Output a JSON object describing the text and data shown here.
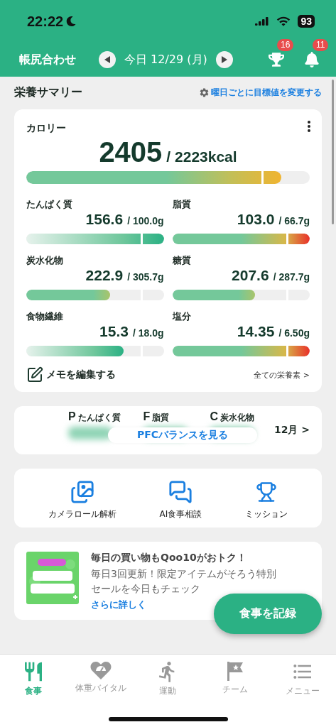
{
  "status_bar": {
    "time": "22:22",
    "battery": "93"
  },
  "header": {
    "title": "帳尻合わせ",
    "date": "今日 12/29 (月)",
    "badges": [
      {
        "kind": "trophy",
        "count": "16"
      },
      {
        "kind": "bell",
        "count": "11"
      }
    ]
  },
  "section": {
    "title": "栄養サマリー",
    "link": "曜日ごとに目標値を変更する"
  },
  "calorie": {
    "label": "カロリー",
    "value": "2405",
    "target": "/ 2223kcal",
    "level": 0.9,
    "kind": "amber"
  },
  "nutrients": [
    {
      "label": "たんぱく質",
      "value": "156.6",
      "target": "/ 100.0g",
      "level": 1,
      "kind": "fade"
    },
    {
      "label": "脂質",
      "value": "103.0",
      "target": "/ 66.7g",
      "level": 1,
      "kind": "warn"
    },
    {
      "label": "炭水化物",
      "value": "222.9",
      "target": "/ 305.7g",
      "level": 0.61,
      "kind": "green"
    },
    {
      "label": "糖質",
      "value": "207.6",
      "target": "/ 287.7g",
      "level": 0.6,
      "kind": "green"
    },
    {
      "label": "食物繊維",
      "value": "15.3",
      "target": "/ 18.0g",
      "level": 0.71,
      "kind": "fade"
    },
    {
      "label": "塩分",
      "value": "14.35",
      "target": "/ 6.50g",
      "level": 1,
      "kind": "warn"
    }
  ],
  "memo": "メモを編集する",
  "all_link": "全ての栄養素 >",
  "pfc": {
    "items": [
      {
        "letter": "P",
        "label": "たんぱく質"
      },
      {
        "letter": "F",
        "label": "脂質"
      },
      {
        "letter": "C",
        "label": "炭水化物"
      }
    ],
    "button": "PFCバランスを見る",
    "month": "12月 >"
  },
  "shortcuts": [
    {
      "kind": "camera",
      "label": "カメラロール解析"
    },
    {
      "kind": "chat",
      "label": "AI食事相談"
    },
    {
      "kind": "trophy",
      "label": "ミッション"
    }
  ],
  "ad": {
    "title": "毎日の買い物もQoo10がおトク！",
    "body": "毎日3回更新！限定アイテムがそろう特別セールを今日もチェック",
    "link": "さらに詳しく"
  },
  "fab": "食事を記録",
  "tabs": [
    {
      "kind": "meal",
      "label": "食事",
      "selected": true
    },
    {
      "kind": "vital",
      "label": "体重バイタル",
      "selected": false
    },
    {
      "kind": "run",
      "label": "運動",
      "selected": false
    },
    {
      "kind": "team",
      "label": "チーム",
      "selected": false
    },
    {
      "kind": "menu",
      "label": "メニュー",
      "selected": false
    }
  ]
}
